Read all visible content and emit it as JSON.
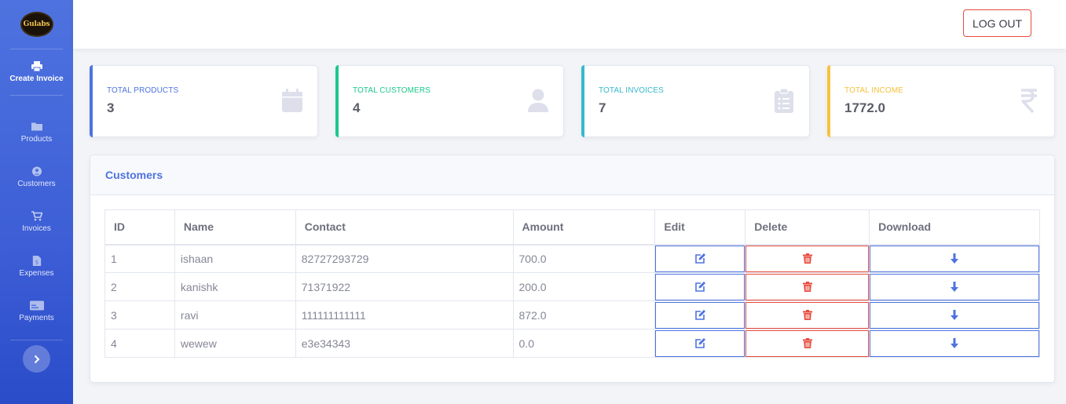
{
  "brand": {
    "logo_text": "Gulabs"
  },
  "sidebar": {
    "create": {
      "label": "Create Invoice",
      "icon": "printer-icon"
    },
    "items": [
      {
        "label": "Products",
        "icon": "folder-icon"
      },
      {
        "label": "Customers",
        "icon": "user-circle-icon"
      },
      {
        "label": "Invoices",
        "icon": "cart-icon"
      },
      {
        "label": "Expenses",
        "icon": "receipt-icon"
      },
      {
        "label": "Payments",
        "icon": "card-icon"
      }
    ],
    "toggle_icon": "chevron-right-icon"
  },
  "topbar": {
    "logout_label": "LOG OUT"
  },
  "stats": [
    {
      "title": "TOTAL PRODUCTS",
      "value": "3",
      "color": "#4e73df",
      "icon": "calendar-icon"
    },
    {
      "title": "TOTAL CUSTOMERS",
      "value": "4",
      "color": "#1cc88a",
      "icon": "user-icon"
    },
    {
      "title": "TOTAL INVOICES",
      "value": "7",
      "color": "#36b9cc",
      "icon": "clipboard-list-icon"
    },
    {
      "title": "TOTAL INCOME",
      "value": "1772.0",
      "color": "#f6c23e",
      "icon": "rupee-icon"
    }
  ],
  "customers": {
    "title": "Customers",
    "columns": [
      "ID",
      "Name",
      "Contact",
      "Amount",
      "Edit",
      "Delete",
      "Download"
    ],
    "rows": [
      {
        "id": "1",
        "name": "ishaan",
        "contact": "82727293729",
        "amount": "700.0"
      },
      {
        "id": "2",
        "name": "kanishk",
        "contact": "71371922",
        "amount": "200.0"
      },
      {
        "id": "3",
        "name": "ravi",
        "contact": "111111111111",
        "amount": "872.0"
      },
      {
        "id": "4",
        "name": "wewew",
        "contact": "e3e34343",
        "amount": "0.0"
      }
    ]
  }
}
